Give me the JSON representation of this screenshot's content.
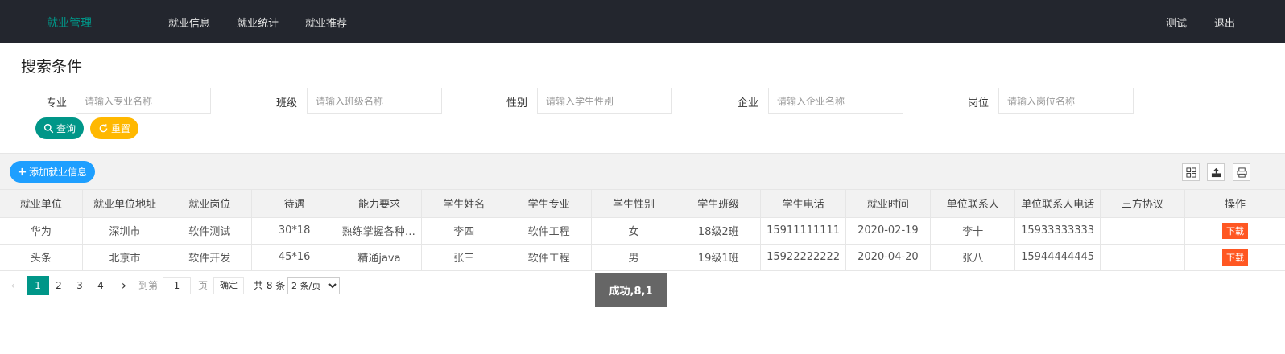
{
  "header": {
    "logo": "就业管理",
    "nav": [
      "就业信息",
      "就业统计",
      "就业推荐"
    ],
    "right": [
      "测试",
      "退出"
    ]
  },
  "search": {
    "legend": "搜索条件",
    "fields": [
      {
        "label": "专业",
        "placeholder": "请输入专业名称"
      },
      {
        "label": "班级",
        "placeholder": "请输入班级名称"
      },
      {
        "label": "性别",
        "placeholder": "请输入学生性别"
      },
      {
        "label": "企业",
        "placeholder": "请输入企业名称"
      },
      {
        "label": "岗位",
        "placeholder": "请输入岗位名称"
      }
    ],
    "query_label": "查询",
    "reset_label": "重置",
    "query_color": "#009688",
    "reset_color": "#ffb800"
  },
  "toolbar": {
    "add_label": "添加就业信息",
    "icons": [
      "columns-icon",
      "export-icon",
      "print-icon"
    ]
  },
  "table": {
    "columns": [
      "就业单位",
      "就业单位地址",
      "就业岗位",
      "待遇",
      "能力要求",
      "学生姓名",
      "学生专业",
      "学生性别",
      "学生班级",
      "学生电话",
      "就业时间",
      "单位联系人",
      "单位联系人电话",
      "三方协议",
      "操作"
    ],
    "rows": [
      [
        "华为",
        "深圳市",
        "软件测试",
        "30*18",
        "熟练掌握各种测试工具",
        "李四",
        "软件工程",
        "女",
        "18级2班",
        "15911111111",
        "2020-02-19",
        "李十",
        "15933333333",
        "",
        "下载"
      ],
      [
        "头条",
        "北京市",
        "软件开发",
        "45*16",
        "精通java",
        "张三",
        "软件工程",
        "男",
        "19级1班",
        "15922222222",
        "2020-04-20",
        "张八",
        "15944444445",
        "",
        "下载"
      ]
    ]
  },
  "pagination": {
    "pages": [
      "1",
      "2",
      "3",
      "4"
    ],
    "current": "1",
    "goto_label": "到第",
    "goto_value": "1",
    "page_unit": "页",
    "confirm_label": "确定",
    "total_label": "共 8 条",
    "page_size": "2 条/页"
  },
  "toast": "成功,8,1"
}
